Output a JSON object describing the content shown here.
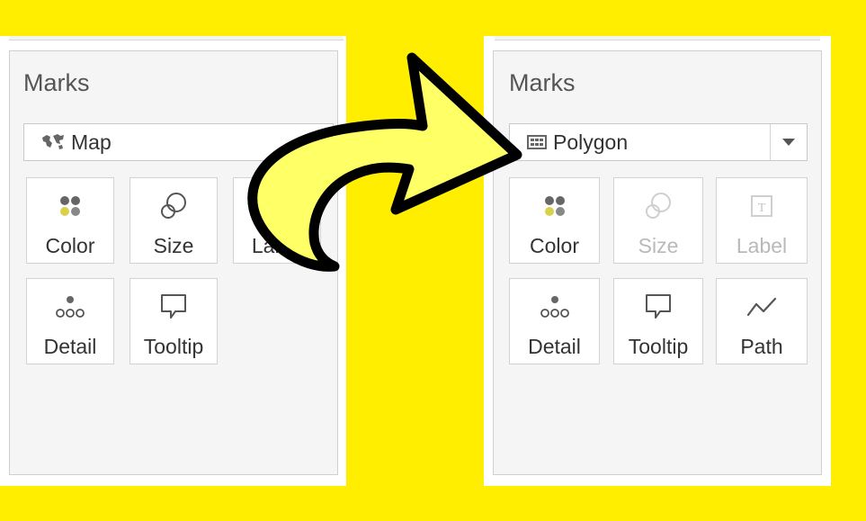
{
  "left_panel": {
    "title": "Marks",
    "mark_type": {
      "value": "Map",
      "icon": "map-icon"
    },
    "cards": [
      {
        "label": "Color",
        "icon": "color-dots-icon",
        "enabled": true
      },
      {
        "label": "Size",
        "icon": "size-circles-icon",
        "enabled": true
      },
      {
        "label": "Label",
        "icon": "label-icon",
        "enabled": true
      },
      {
        "label": "Detail",
        "icon": "detail-dots-icon",
        "enabled": true
      },
      {
        "label": "Tooltip",
        "icon": "tooltip-icon",
        "enabled": true
      }
    ]
  },
  "right_panel": {
    "title": "Marks",
    "mark_type": {
      "value": "Polygon",
      "icon": "polygon-icon"
    },
    "cards": [
      {
        "label": "Color",
        "icon": "color-dots-icon",
        "enabled": true
      },
      {
        "label": "Size",
        "icon": "size-circles-icon",
        "enabled": false
      },
      {
        "label": "Label",
        "icon": "label-icon",
        "enabled": false
      },
      {
        "label": "Detail",
        "icon": "detail-dots-icon",
        "enabled": true
      },
      {
        "label": "Tooltip",
        "icon": "tooltip-icon",
        "enabled": true
      },
      {
        "label": "Path",
        "icon": "path-icon",
        "enabled": true
      }
    ]
  },
  "colors": {
    "background": "#ffee00",
    "arrow": "#ffff66",
    "arrow_outline": "#000000"
  }
}
